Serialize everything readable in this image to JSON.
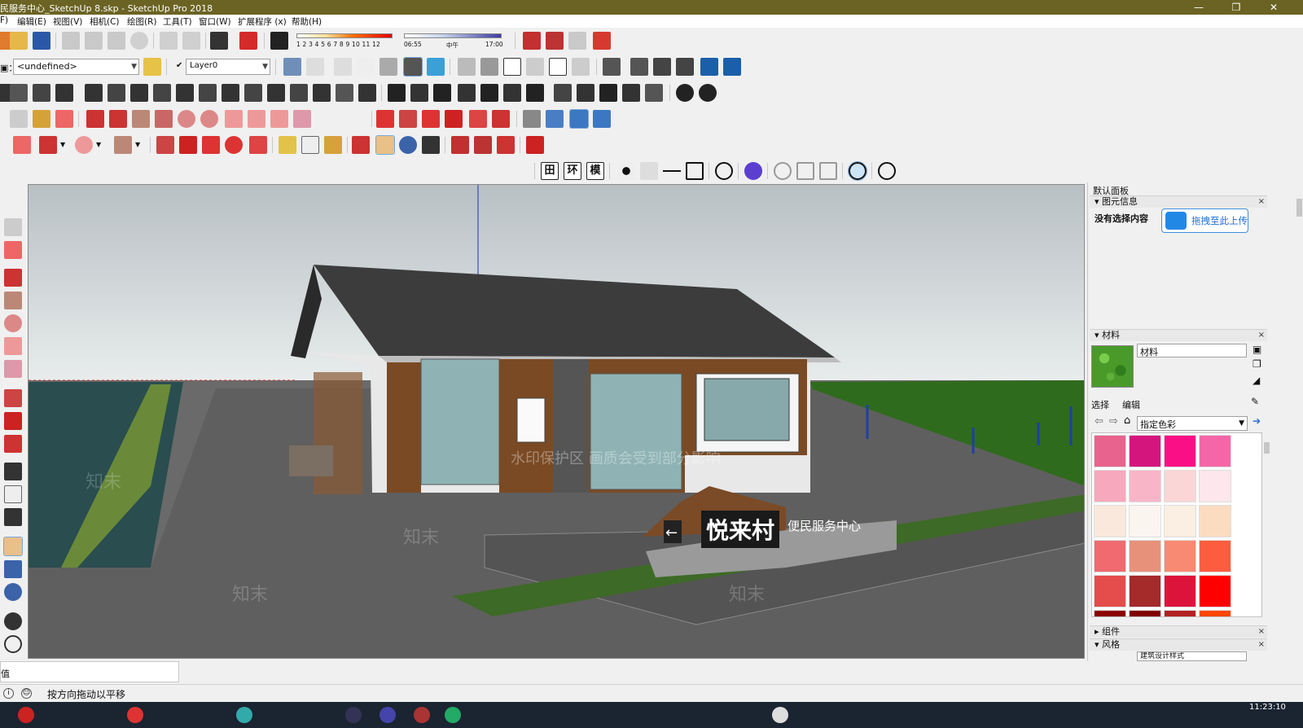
{
  "window": {
    "title": "民服务中心_SketchUp 8.skp - SketchUp Pro 2018",
    "minimize": "—",
    "restore": "❐",
    "close": "✕"
  },
  "menu": [
    "F)",
    "编辑(E)",
    "视图(V)",
    "相机(C)",
    "绘图(R)",
    "工具(T)",
    "窗口(W)",
    "扩展程序 (x)",
    "帮助(H)"
  ],
  "toolbar": {
    "shadow_months": "1 2 3 4 5 6 7 8 9 10 11 12",
    "time_start": "06:55",
    "time_mid": "中午",
    "time_end": "17:00",
    "style_value": "<undefined>",
    "layer_check": "✔",
    "layer_value": "Layer0",
    "style_label": "▣："
  },
  "view_toolbar": {
    "ortho": "田",
    "env": "环",
    "model": "模"
  },
  "tray": {
    "title": "默认面板",
    "entity_info": {
      "header": "图元信息",
      "text": "没有选择内容",
      "upload_label": "拖拽至此上传"
    },
    "materials": {
      "header": "材料",
      "name": "材料",
      "tab_select": "选择",
      "tab_edit": "编辑",
      "collection": "指定色彩",
      "swatches": [
        "#e8638e",
        "#d5157e",
        "#fb0f86",
        "#f566a8",
        "#f8a8bd",
        "#f8b5c8",
        "#fbd6d6",
        "#fde6ec",
        "#fae8dc",
        "#fbf5f0",
        "#fbeee2",
        "#fcdcc0",
        "#f06a6f",
        "#e8917a",
        "#f88a73",
        "#fb5d3e",
        "#e54c4c",
        "#a52a2a",
        "#dc143c",
        "#ff0000",
        "#8b0000",
        "#800000",
        "#b22222",
        "#ff4500"
      ]
    },
    "components": {
      "header": "组件"
    },
    "styles": {
      "header": "风格",
      "value": "建筑设计样式"
    }
  },
  "measurements": {
    "label": "值"
  },
  "status": {
    "message": "按方向拖动以平移",
    "ic1": "i",
    "ic2": "☺"
  },
  "scene": {
    "sign_main": "悦来村",
    "sign_sub": "便民服务中心",
    "sign_arrow": "←",
    "watermark": "水印保护区  画质会受到部分影响",
    "wm_brand": "知末"
  },
  "taskbar": {
    "clock": "11:23:10"
  }
}
